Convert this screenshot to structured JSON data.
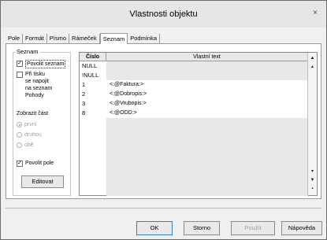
{
  "window": {
    "title": "Vlastnosti objektu",
    "close_glyph": "×"
  },
  "tabs": [
    {
      "label": "Pole"
    },
    {
      "label": "Formát"
    },
    {
      "label": "Písmo"
    },
    {
      "label": "Rámeček"
    },
    {
      "label": "Seznam",
      "active": true
    },
    {
      "label": "Podmínka"
    }
  ],
  "seznam_group": {
    "title": "Seznam",
    "povolit_seznam": {
      "label": "Povolit seznam",
      "checked": true
    },
    "pri_tisku": {
      "label_lines": [
        "Při tisku",
        "se napojit",
        "na seznam",
        "Pohody"
      ],
      "checked": false
    },
    "zobrazit_label": "Zobrazit část",
    "radios": [
      {
        "label": "první",
        "selected": true
      },
      {
        "label": "druhou",
        "selected": false
      },
      {
        "label": "obě",
        "selected": false
      }
    ],
    "povolit_pole": {
      "label": "Povolit pole",
      "checked": true
    },
    "edit_button": "Editovat"
  },
  "table": {
    "columns": [
      "Číslo",
      "Vlastní text"
    ],
    "rows": [
      {
        "cislo": "NULL",
        "text": ""
      },
      {
        "cislo": "!NULL",
        "text": ""
      },
      {
        "cislo": "1",
        "text": "<:@Faktura:>"
      },
      {
        "cislo": "2",
        "text": "<:@Dobropis:>"
      },
      {
        "cislo": "3",
        "text": "<:@Vrubopis:>"
      },
      {
        "cislo": "8",
        "text": "<:@ODD:>"
      }
    ]
  },
  "buttons": {
    "ok": "OK",
    "storno": "Storno",
    "pouzit": "Použít",
    "napoveda": "Nápověda"
  },
  "colors": {
    "accent": "#3c7fb1",
    "disabled_text": "#a0a0a0"
  }
}
